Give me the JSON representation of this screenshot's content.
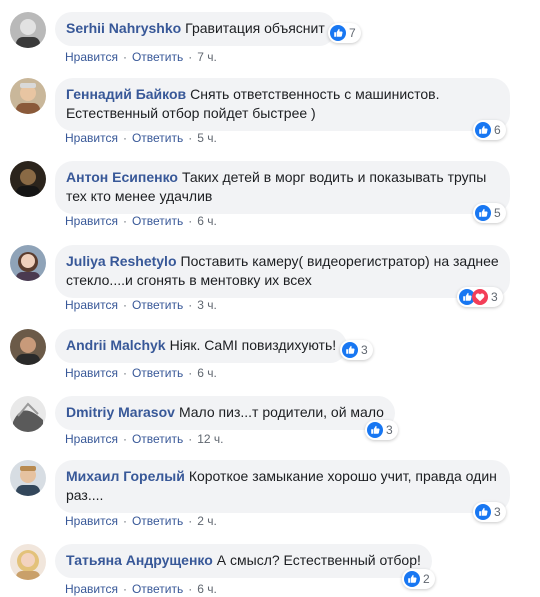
{
  "actions": {
    "like": "Нравится",
    "reply": "Ответить",
    "dot": "·"
  },
  "colors": {
    "author": "#385898",
    "bubble": "#f2f3f5",
    "like": "#1877f2",
    "love": "#f33e58"
  },
  "comments": [
    {
      "author": "Serhii Nahryshko",
      "text": "Гравитация объяснит",
      "reaction_count": "7",
      "reactions": [
        "like-icon"
      ],
      "time": "7 ч."
    },
    {
      "author": "Геннадий Байков",
      "text": "Снять ответственность с машинистов. Естественный отбор пойдет быстрее )",
      "reaction_count": "6",
      "reactions": [
        "like-icon"
      ],
      "time": "5 ч."
    },
    {
      "author": "Антон Есипенко",
      "text": "Таких детей в морг водить и показывать трупы тех кто менее удачлив",
      "reaction_count": "5",
      "reactions": [
        "like-icon"
      ],
      "time": "6 ч."
    },
    {
      "author": "Juliya Reshetylo",
      "text": "Поставить камеру( видеорегистратор) на заднее стекло....и сгонять в ментовку их всех",
      "reaction_count": "3",
      "reactions": [
        "like-icon",
        "love-icon"
      ],
      "time": "3 ч."
    },
    {
      "author": "Andrii Malchyk",
      "text": "Ніяк. CaMI повиздихують!",
      "reaction_count": "3",
      "reactions": [
        "like-icon"
      ],
      "time": "6 ч."
    },
    {
      "author": "Dmitriy Marasov",
      "text": "Мало пиз...т родители, ой мало",
      "reaction_count": "3",
      "reactions": [
        "like-icon"
      ],
      "time": "12 ч."
    },
    {
      "author": "Михаил Горелый",
      "text": "Короткое замыкание хорошо учит, правда один раз....",
      "reaction_count": "3",
      "reactions": [
        "like-icon"
      ],
      "time": "2 ч."
    },
    {
      "author": "Татьяна Андрущенко",
      "text": "А смысл? Естественный отбор!",
      "reaction_count": "2",
      "reactions": [
        "like-icon"
      ],
      "time": "6 ч."
    }
  ]
}
